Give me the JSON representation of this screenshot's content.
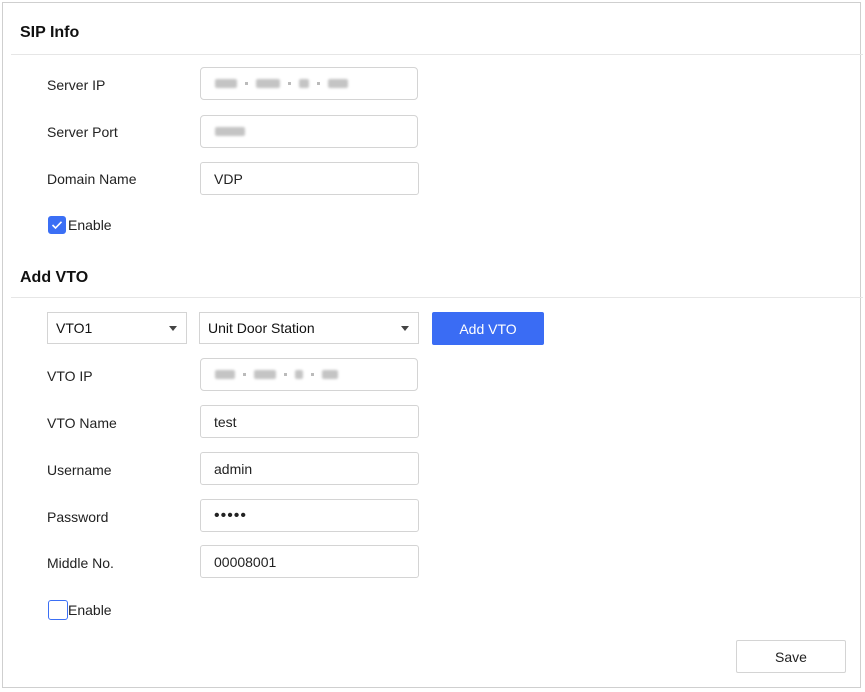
{
  "sip_info": {
    "title": "SIP Info",
    "server_ip_label": "Server IP",
    "server_port_label": "Server Port",
    "domain_name_label": "Domain Name",
    "domain_name_value": "VDP",
    "enable_label": "Enable",
    "enable_checked": true
  },
  "add_vto": {
    "title": "Add VTO",
    "vto_select_value": "VTO1",
    "type_select_value": "Unit Door Station",
    "add_button_label": "Add VTO",
    "vto_ip_label": "VTO IP",
    "vto_name_label": "VTO Name",
    "vto_name_value": "test",
    "username_label": "Username",
    "username_value": "admin",
    "password_label": "Password",
    "password_value": "•••••",
    "middle_no_label": "Middle No.",
    "middle_no_value": "00008001",
    "enable_label": "Enable",
    "enable_checked": false
  },
  "footer": {
    "save_label": "Save"
  },
  "colors": {
    "accent": "#3a6cf4",
    "border": "#d4d4d4"
  }
}
